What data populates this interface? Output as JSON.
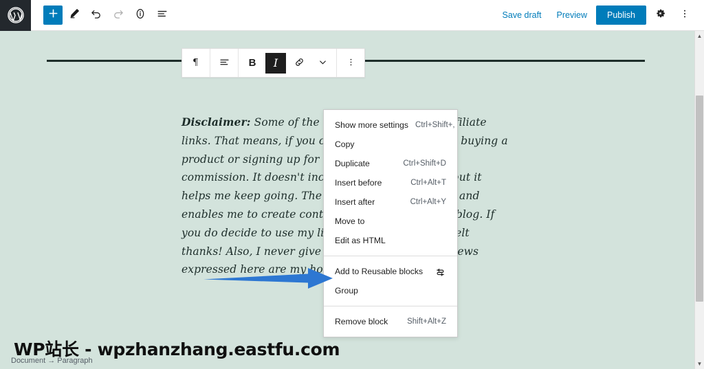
{
  "topbar": {
    "logo_icon": "wordpress-logo-icon",
    "left_tools": [
      {
        "name": "add-block-button",
        "icon": "plus-icon",
        "label": "+",
        "active": true
      },
      {
        "name": "tools-pencil-button",
        "icon": "pencil-icon",
        "label": ""
      },
      {
        "name": "undo-button",
        "icon": "undo-icon",
        "label": ""
      },
      {
        "name": "redo-button",
        "icon": "redo-icon",
        "label": ""
      },
      {
        "name": "details-info-button",
        "icon": "info-circle-icon",
        "label": ""
      },
      {
        "name": "list-view-button",
        "icon": "list-view-icon",
        "label": ""
      }
    ],
    "save_draft_label": "Save draft",
    "preview_label": "Preview",
    "publish_label": "Publish",
    "settings_icon": "gear-icon",
    "more_icon": "kebab-menu-icon"
  },
  "block_toolbar": {
    "items": [
      {
        "name": "block-type-paragraph-button",
        "glyph": "¶",
        "icon": "paragraph-icon"
      },
      {
        "name": "align-text-button",
        "glyph": "",
        "icon": "align-left-icon"
      },
      {
        "name": "bold-button",
        "glyph": "B",
        "icon": "bold-icon"
      },
      {
        "name": "italic-button",
        "glyph": "I",
        "icon": "italic-icon"
      },
      {
        "name": "link-button",
        "glyph": "",
        "icon": "link-icon"
      },
      {
        "name": "more-rich-text-button",
        "glyph": "",
        "icon": "chevron-down-icon"
      },
      {
        "name": "block-options-button",
        "glyph": "",
        "icon": "kebab-menu-icon"
      }
    ]
  },
  "content": {
    "separator_name": "separator-block",
    "paragraph_lead": "Disclaimer:",
    "paragraph_body": " Some of the links on this page are affiliate links. That means, if you click on them and end up buying a product or signing up for a service, I earn a small commission. It doesn't increase the price for you but it helps me keep going. The money pays for this site and enables me to create content and tutorials on the blog. If you do decide to use my links, you have my heartfelt thanks! Also, I never give dishonest reviews. All views expressed here are my honest opinion."
  },
  "dropdown": {
    "sections": [
      {
        "items": [
          {
            "label": "Show more settings",
            "shortcut": "Ctrl+Shift+,",
            "icon": ""
          },
          {
            "label": "Copy",
            "shortcut": "",
            "icon": ""
          },
          {
            "label": "Duplicate",
            "shortcut": "Ctrl+Shift+D",
            "icon": ""
          },
          {
            "label": "Insert before",
            "shortcut": "Ctrl+Alt+T",
            "icon": ""
          },
          {
            "label": "Insert after",
            "shortcut": "Ctrl+Alt+Y",
            "icon": ""
          },
          {
            "label": "Move to",
            "shortcut": "",
            "icon": ""
          },
          {
            "label": "Edit as HTML",
            "shortcut": "",
            "icon": ""
          }
        ]
      },
      {
        "items": [
          {
            "label": "Add to Reusable blocks",
            "shortcut": "",
            "icon": "reusable-block-icon"
          },
          {
            "label": "Group",
            "shortcut": "",
            "icon": ""
          }
        ]
      },
      {
        "items": [
          {
            "label": "Remove block",
            "shortcut": "Shift+Alt+Z",
            "icon": ""
          }
        ]
      }
    ]
  },
  "annotation": {
    "name": "blue-pointer-arrow",
    "color": "#2d77d2",
    "points_to": "Add to Reusable blocks"
  },
  "breadcrumb": {
    "text": "Document  →  Paragraph"
  },
  "watermark": {
    "text": "WP站长 - wpzhanzhang.eastfu.com"
  },
  "scrollbar": {
    "up_glyph": "▲",
    "down_glyph": "▼"
  },
  "colors": {
    "canvas_bg": "#d3e3dc",
    "wp_blue": "#007cba",
    "admin_dark": "#23282d",
    "text_dark": "#1d2d2a",
    "arrow_blue": "#2d77d2"
  }
}
